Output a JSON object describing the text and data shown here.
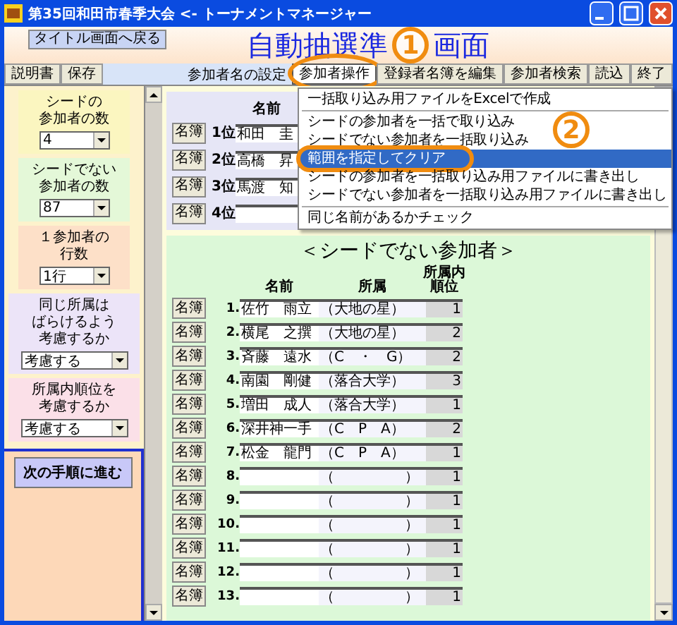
{
  "window": {
    "title": "第35回和田市春季大会 <- トーナメントマネージャー"
  },
  "header": {
    "back_button": "タイトル画面へ戻る",
    "title_parts": [
      "自動抽選準",
      "画面"
    ]
  },
  "toolbar": {
    "left_buttons": [
      "説明書",
      "保存"
    ],
    "label": "参加者名の設定",
    "right_buttons": [
      {
        "label": "参加者操作",
        "selected": true
      },
      {
        "label": "登録者名簿を編集",
        "selected": false
      },
      {
        "label": "参加者検索",
        "selected": false
      },
      {
        "label": "読込",
        "selected": false
      },
      {
        "label": "終了",
        "selected": false
      }
    ]
  },
  "settings": [
    {
      "label_lines": [
        "シードの",
        "参加者の数"
      ],
      "value": "4",
      "color": "#fbf6c0"
    },
    {
      "label_lines": [
        "シードでない",
        "参加者の数"
      ],
      "value": "87",
      "color": "#e4f8d8"
    },
    {
      "label_lines": [
        "１参加者の",
        "行数"
      ],
      "value": "1行",
      "color": "#fde0c8"
    },
    {
      "label_lines": [
        "同じ所属は",
        "ばらけるよう",
        "考慮するか"
      ],
      "value": "考慮する",
      "color": "#ece4f8"
    },
    {
      "label_lines": [
        "所属内順位を",
        "考慮するか"
      ],
      "value": "考慮する",
      "color": "#fbe0e8"
    }
  ],
  "next_button": "次の手順に進む",
  "seeded": {
    "column": "名前",
    "rows": [
      {
        "button": "名簿",
        "rank": "1位",
        "name": "和田　圭"
      },
      {
        "button": "名簿",
        "rank": "2位",
        "name": "高橋　昇"
      },
      {
        "button": "名簿",
        "rank": "3位",
        "name": "馬渡　知"
      },
      {
        "button": "名簿",
        "rank": "4位",
        "name": ""
      }
    ]
  },
  "unseeded": {
    "title": "＜シードでない参加者＞",
    "columns": [
      [
        "名前"
      ],
      [
        "所属"
      ],
      [
        "所属内",
        "順位"
      ]
    ],
    "rows": [
      {
        "button": "名簿",
        "number": "1.",
        "name": "佐竹　雨立",
        "team": "（大地の星）",
        "rank": "1"
      },
      {
        "button": "名簿",
        "number": "2.",
        "name": "横尾　之撰",
        "team": "（大地の星）",
        "rank": "2"
      },
      {
        "button": "名簿",
        "number": "3.",
        "name": "斉藤　遠水",
        "team": "（C　・　G）",
        "rank": "2"
      },
      {
        "button": "名簿",
        "number": "4.",
        "name": "南園　剛健",
        "team": "（落合大学）",
        "rank": "3"
      },
      {
        "button": "名簿",
        "number": "5.",
        "name": "増田　成人",
        "team": "（落合大学）",
        "rank": "1"
      },
      {
        "button": "名簿",
        "number": "6.",
        "name": "深井神一手",
        "team": "（C　P　A）",
        "rank": "2"
      },
      {
        "button": "名簿",
        "number": "7.",
        "name": "松金　龍門",
        "team": "（C　P　A）",
        "rank": "1"
      },
      {
        "button": "名簿",
        "number": "8.",
        "name": "",
        "team": "（　　　　　）",
        "rank": "1"
      },
      {
        "button": "名簿",
        "number": "9.",
        "name": "",
        "team": "（　　　　　）",
        "rank": "1"
      },
      {
        "button": "名簿",
        "number": "10.",
        "name": "",
        "team": "（　　　　　）",
        "rank": "1"
      },
      {
        "button": "名簿",
        "number": "11.",
        "name": "",
        "team": "（　　　　　）",
        "rank": "1"
      },
      {
        "button": "名簿",
        "number": "12.",
        "name": "",
        "team": "（　　　　　）",
        "rank": "1"
      },
      {
        "button": "名簿",
        "number": "13.",
        "name": "",
        "team": "（　　　　　）",
        "rank": "1"
      }
    ]
  },
  "menu": {
    "items": [
      {
        "label": "一括取り込み用ファイルをExcelで作成",
        "selected": false,
        "separator_after": true
      },
      {
        "label": "シードの参加者を一括で取り込み",
        "selected": false,
        "separator_after": false
      },
      {
        "label": "シードでない参加者を一括取り込み",
        "selected": false,
        "separator_after": false
      },
      {
        "label": "範囲を指定してクリア",
        "selected": true,
        "separator_after": false
      },
      {
        "label": "シードの参加者を一括取り込み用ファイルに書き出し",
        "selected": false,
        "separator_after": false
      },
      {
        "label": "シードでない参加者を一括取り込み用ファイルに書き出し",
        "selected": false,
        "separator_after": true
      },
      {
        "label": "同じ名前があるかチェック",
        "selected": false,
        "separator_after": false
      }
    ]
  },
  "annotations": [
    {
      "number": "1"
    },
    {
      "number": "2"
    }
  ]
}
